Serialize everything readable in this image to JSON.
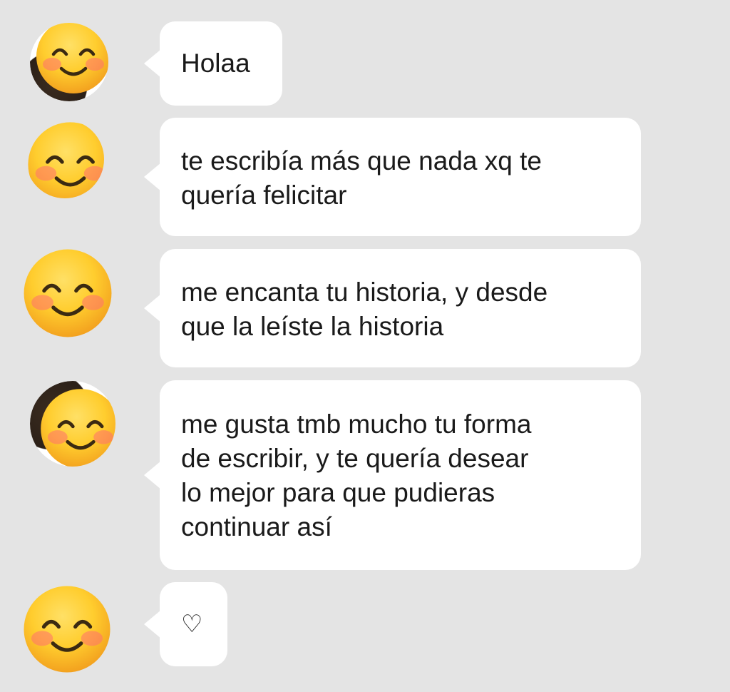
{
  "conversation": {
    "messages": [
      {
        "avatar_icon": "smiling-face-emoji",
        "lines": [
          "Holaa"
        ]
      },
      {
        "avatar_icon": "smiling-face-emoji",
        "lines": [
          "te escribía más que nada xq te",
          "quería felicitar"
        ]
      },
      {
        "avatar_icon": "smiling-face-emoji",
        "lines": [
          "me encanta tu historia, y desde",
          "que la leíste la historia"
        ]
      },
      {
        "avatar_icon": "smiling-face-emoji",
        "lines": [
          "me gusta tmb mucho tu forma",
          "de escribir, y te quería desear",
          "lo mejor para que pudieras",
          "continuar así"
        ]
      },
      {
        "avatar_icon": "smiling-face-emoji",
        "lines": [
          "♡"
        ]
      }
    ]
  },
  "colors": {
    "background": "#e4e4e4",
    "bubble": "#ffffff",
    "text": "#1a1a1a",
    "emoji_face": "#ffcd2e"
  }
}
